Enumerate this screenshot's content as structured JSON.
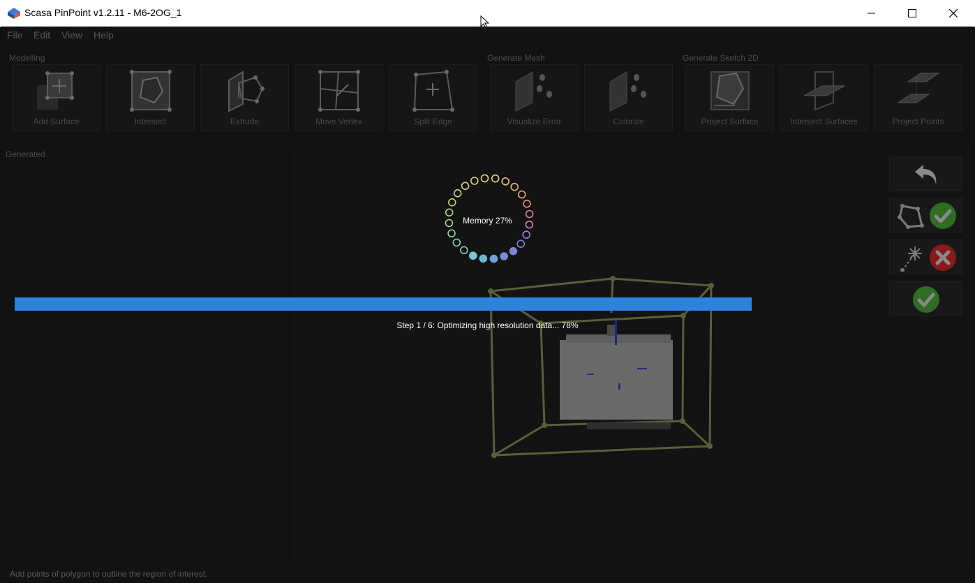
{
  "window": {
    "title": "Scasa PinPoint v1.2.11 - M6-2OG_1"
  },
  "menu": [
    "File",
    "Edit",
    "View",
    "Help"
  ],
  "groups": {
    "modelling": "Modelling",
    "generate_mesh": "Generate Mesh",
    "generate_sketch": "Generate Sketch 2D"
  },
  "tools": [
    {
      "label": "Add Surface",
      "icon": "add-surface-icon"
    },
    {
      "label": "Intersect",
      "icon": "intersect-icon"
    },
    {
      "label": "Extrude",
      "icon": "extrude-icon"
    },
    {
      "label": "Move Vertex",
      "icon": "move-vertex-icon"
    },
    {
      "label": "Split Edge",
      "icon": "split-edge-icon"
    },
    {
      "label": "Visualize Error",
      "icon": "visualize-error-icon"
    },
    {
      "label": "Colorize",
      "icon": "colorize-icon"
    },
    {
      "label": "Project Surface",
      "icon": "project-surface-icon"
    },
    {
      "label": "Intersect Surfaces",
      "icon": "intersect-surfaces-icon"
    },
    {
      "label": "Project Points",
      "icon": "project-points-icon"
    }
  ],
  "panel": {
    "generated_label": "Generated"
  },
  "loading": {
    "memory_text": "Memory 27%",
    "step_text": "Step 1 / 6: Optimizing high resolution data... 78%",
    "progress": 1.0
  },
  "status_bar": {
    "message": "Add points of polygon to outline the region of interest."
  },
  "colors": {
    "progress": "#2b83dd",
    "accept": "#3c8a2e",
    "reject": "#b32020",
    "box": "#566038"
  }
}
